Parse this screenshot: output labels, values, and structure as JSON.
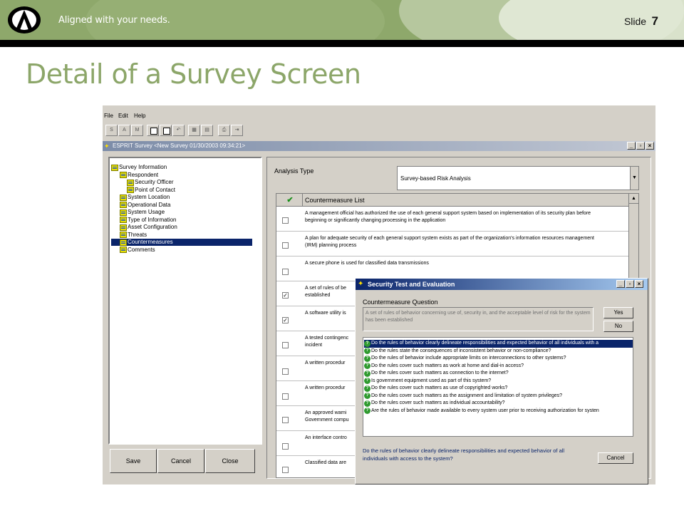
{
  "header": {
    "tagline": "Aligned with your needs.",
    "slide_label": "Slide",
    "slide_number": "7"
  },
  "title": "Detail of a Survey Screen",
  "app": {
    "menu": [
      "File",
      "Edit",
      "Help"
    ],
    "toolbar_letters": [
      "S",
      "A",
      "M"
    ],
    "window_title": "ESPRIT Survey  <New Survey 01/30/2003 09:34:21>",
    "tree": [
      {
        "label": "Survey Information",
        "level": 0
      },
      {
        "label": "Respondent",
        "level": 1
      },
      {
        "label": "Security Officer",
        "level": 2
      },
      {
        "label": "Point of Contact",
        "level": 2
      },
      {
        "label": "System Location",
        "level": 1
      },
      {
        "label": "Operational Data",
        "level": 1
      },
      {
        "label": "System Usage",
        "level": 1
      },
      {
        "label": "Type of Information",
        "level": 1
      },
      {
        "label": "Asset Configuration",
        "level": 1
      },
      {
        "label": "Threats",
        "level": 1
      },
      {
        "label": "Countermeasures",
        "level": 1,
        "selected": true
      },
      {
        "label": "Comments",
        "level": 1
      }
    ],
    "buttons": {
      "save": "Save",
      "cancel": "Cancel",
      "close": "Close"
    },
    "analysis_type_label": "Analysis Type",
    "analysis_type_value": "Survey-based Risk Analysis",
    "countermeasure_header": "Countermeasure List",
    "countermeasures": [
      {
        "checked": false,
        "text": "A management official has authorized the use of each general support system based on implementation of its security plan before beginning or significantly changing processing in the application"
      },
      {
        "checked": false,
        "text": "A plan for adequate security of each general support system exists as part of the organization's information resources management (IRM) planning process"
      },
      {
        "checked": false,
        "text": "A secure phone is used for classified data transmissions"
      },
      {
        "checked": true,
        "text": "A set of rules of be established"
      },
      {
        "checked": true,
        "text": "A software utility is"
      },
      {
        "checked": false,
        "text": "A tested contingenc incident"
      },
      {
        "checked": false,
        "text": "A written procedur"
      },
      {
        "checked": false,
        "text": "A written procedur"
      },
      {
        "checked": false,
        "text": "An approved warni Government compu"
      },
      {
        "checked": false,
        "text": "An interface contro"
      },
      {
        "checked": false,
        "text": "Classified data are"
      }
    ]
  },
  "dialog": {
    "title": "Security Test and Evaluation",
    "question_label": "Countermeasure Question",
    "question_text": "A set of rules of behavior concerning use of, security in, and the acceptable level of risk for the system has been established",
    "yes": "Yes",
    "no": "No",
    "questions": [
      {
        "text": "Do the rules of behavior clearly delineate responsibilities and expected behavior of all individuals with a",
        "selected": true
      },
      {
        "text": "Do the rules state the consequences of inconsistent behavior or non-compliance?"
      },
      {
        "text": "Do the rules of behavior include appropriate limits on interconnections to other systems?"
      },
      {
        "text": "Do the rules cover such matters as work at home and dial-in access?"
      },
      {
        "text": "Do the rules cover such matters as connection to the internet?"
      },
      {
        "text": "Is government equipment used as part of this system?"
      },
      {
        "text": "Do the rules cover such matters as use of copyrighted works?"
      },
      {
        "text": "Do the rules cover such matters as the assignment and limitation of system privileges?"
      },
      {
        "text": "Do the rules cover such matters as individual accountability?"
      },
      {
        "text": "Are the rules of behavior made available to every system user prior to receiving authorization for systen"
      }
    ],
    "footer_text": "Do the rules of behavior clearly delineate responsibilities and expected behavior of all individuals with access to the system?",
    "cancel": "Cancel"
  }
}
